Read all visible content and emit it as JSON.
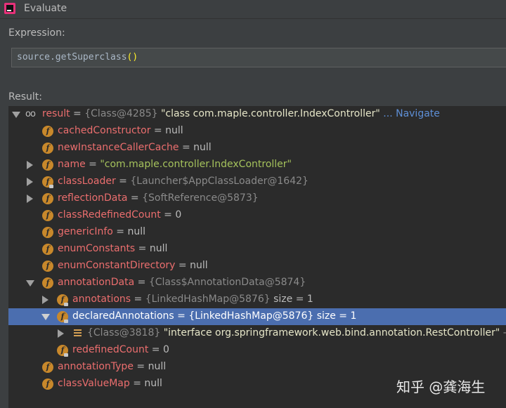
{
  "window": {
    "title": "Evaluate"
  },
  "expression": {
    "label": "Expression:",
    "value_prefix": "source.getSuperclass",
    "value_parens": "()"
  },
  "result": {
    "label": "Result:",
    "root": {
      "name": "result",
      "eq": " = ",
      "type": "{Class@4285}",
      "value": " \"class com.maple.controller.IndexController\"",
      "navigate": " ... Navigate"
    },
    "rows": [
      {
        "name": "cachedConstructor",
        "rest": " = null"
      },
      {
        "name": "newInstanceCallerCache",
        "rest": " = null"
      },
      {
        "name": "name",
        "eq": " = ",
        "value": "\"com.maple.controller.IndexController\""
      },
      {
        "name": "classLoader",
        "eq": " = ",
        "type": "{Launcher$AppClassLoader@1642}"
      },
      {
        "name": "reflectionData",
        "eq": " = ",
        "type": "{SoftReference@5873}"
      },
      {
        "name": "classRedefinedCount",
        "rest": " = 0"
      },
      {
        "name": "genericInfo",
        "rest": " = null"
      },
      {
        "name": "enumConstants",
        "rest": " = null"
      },
      {
        "name": "enumConstantDirectory",
        "rest": " = null"
      },
      {
        "name": "annotationData",
        "eq": " = ",
        "type": "{Class$AnnotationData@5874}"
      },
      {
        "name": "annotations",
        "eq": " = ",
        "type": "{LinkedHashMap@5876}",
        "extra": "  size = 1"
      },
      {
        "name": "declaredAnnotations",
        "eq": " = ",
        "type": "{LinkedHashMap@5876}",
        "extra": "  size = 1"
      },
      {
        "type": "{Class@3818}",
        "value": " \"interface org.springframework.web.bind.annotation.RestController\"",
        "tail": " ->"
      },
      {
        "name": "redefinedCount",
        "rest": " = 0"
      },
      {
        "name": "annotationType",
        "rest": " = null"
      },
      {
        "name": "classValueMap",
        "rest": " = null"
      }
    ]
  },
  "watermark": "知乎 @龚海生",
  "colors": {
    "background": "#3c3f41",
    "tree_bg": "#2b2b2b",
    "selection": "#4b6eaf",
    "field_name": "#eb6e6e",
    "field_icon": "#c8882b",
    "link": "#5e8fd6"
  },
  "icons": [
    "intellij-app-icon",
    "watch-glasses-icon",
    "field-icon",
    "entry-icon",
    "expand-arrow-icon",
    "collapse-arrow-icon"
  ]
}
